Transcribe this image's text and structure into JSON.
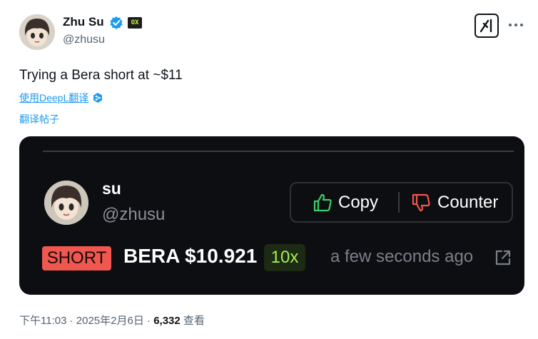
{
  "author": {
    "name": "Zhu Su",
    "handle": "@zhusu",
    "affiliate_badge": "OX"
  },
  "tweet": {
    "text": "Trying a Bera short at ~$11",
    "deepl_link": "使用DeepL翻译",
    "translate_link": "翻译帖子"
  },
  "card": {
    "name": "su",
    "handle": "@zhusu",
    "copy_label": "Copy",
    "counter_label": "Counter",
    "side": "SHORT",
    "pair_price": "BERA $10.921",
    "leverage": "10x",
    "time_ago": "a few seconds ago",
    "colors": {
      "short": "#f0574f",
      "copy": "#3ccf6a",
      "counter": "#f0574f",
      "leverage_text": "#a3f04d"
    }
  },
  "meta": {
    "time": "下午11:03",
    "separator": "·",
    "date": "2025年2月6日",
    "views_count": "6,332",
    "views_label": "查看"
  },
  "icons": {
    "verified": "verified-badge-icon",
    "grok": "grok-icon",
    "more": "more-dots-icon",
    "thumbs_up": "thumbs-up-icon",
    "thumbs_down": "thumbs-down-icon",
    "external": "external-link-icon"
  }
}
